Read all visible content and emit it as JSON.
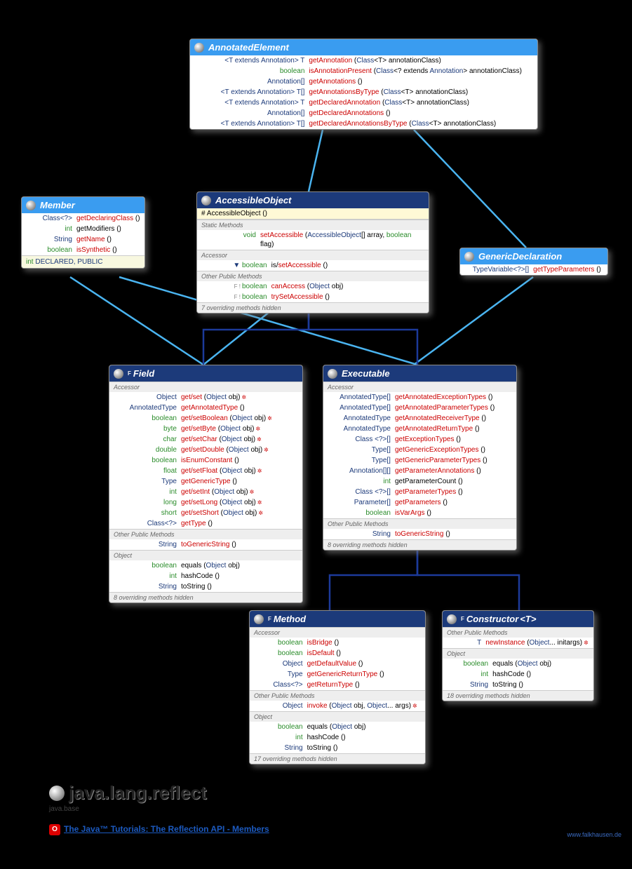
{
  "package": {
    "name": "java.lang.reflect",
    "module": "java.base",
    "tutorial_label": "The Java™ Tutorials: The Reflection API - Members",
    "site": "www.falkhausen.de"
  },
  "AnnotatedElement": {
    "title": "AnnotatedElement",
    "rows": [
      {
        "ret": "<T extends <t>Annotation</t>> T",
        "name": "getAnnotation",
        "args": "(<t>Class</t><T> annotationClass)"
      },
      {
        "ret": "<kw>boolean</kw>",
        "name": "isAnnotationPresent",
        "args": "(<t>Class</t><? extends <t>Annotation</t>> annotationClass)"
      },
      {
        "ret": "<t>Annotation</t>[]",
        "name": "getAnnotations",
        "args": "()"
      },
      {
        "ret": "<T extends <t>Annotation</t>> T[]",
        "name": "getAnnotationsByType",
        "args": "(<t>Class</t><T> annotationClass)"
      },
      {
        "ret": "<T extends <t>Annotation</t>> T",
        "name": "getDeclaredAnnotation",
        "args": "(<t>Class</t><T> annotationClass)"
      },
      {
        "ret": "<t>Annotation</t>[]",
        "name": "getDeclaredAnnotations",
        "args": "()"
      },
      {
        "ret": "<T extends <t>Annotation</t>> T[]",
        "name": "getDeclaredAnnotationsByType",
        "args": "(<t>Class</t><T> annotationClass)"
      }
    ]
  },
  "Member": {
    "title": "Member",
    "rows": [
      {
        "ret": "<t>Class</t><?>",
        "name": "getDeclaringClass",
        "args": "()"
      },
      {
        "ret": "<kw>int</kw>",
        "name_black": "getModifiers",
        "args": "()"
      },
      {
        "ret": "<t>String</t>",
        "name": "getName",
        "args": "()"
      },
      {
        "ret": "<kw>boolean</kw>",
        "name": "isSynthetic",
        "args": "()"
      }
    ],
    "consts": "int DECLARED, PUBLIC"
  },
  "AccessibleObject": {
    "title": "AccessibleObject",
    "constructor": "# AccessibleObject ()",
    "sections": {
      "static": "Static Methods",
      "static_rows": [
        {
          "ret": "<kw>void</kw>",
          "name": "setAccessible",
          "args": "(<t>AccessibleObject</t>[] array, <kw>boolean</kw> flag)"
        }
      ],
      "accessor": "Accessor",
      "accessor_rows": [
        {
          "ret": "▼ <kw>boolean</kw>",
          "name_black": "is/",
          "name": "setAccessible",
          "args": "()"
        }
      ],
      "other": "Other Public Methods",
      "other_rows": [
        {
          "flag": "F !",
          "ret": "<kw>boolean</kw>",
          "name": "canAccess",
          "args": "(<t>Object</t> obj)"
        },
        {
          "flag": "F !",
          "ret": "<kw>boolean</kw>",
          "name": "trySetAccessible",
          "args": "()"
        }
      ],
      "hidden": "7 overriding methods hidden"
    }
  },
  "GenericDeclaration": {
    "title": "GenericDeclaration",
    "rows": [
      {
        "ret": "<t>TypeVariable</t><?>[]",
        "name": "getTypeParameters",
        "args": "()"
      }
    ]
  },
  "Field": {
    "title": "Field",
    "sup": "F",
    "accessor": "Accessor",
    "rows": [
      {
        "ret": "<t>Object</t>",
        "name": "get/set",
        "args": "(<t>Object</t> obj)",
        "ex": true
      },
      {
        "ret": "<t>AnnotatedType</t>",
        "name": "getAnnotatedType",
        "args": "()"
      },
      {
        "ret": "<kw>boolean</kw>",
        "name": "get/setBoolean",
        "args": "(<t>Object</t> obj)",
        "ex": true
      },
      {
        "ret": "<kw>byte</kw>",
        "name": "get/setByte",
        "args": "(<t>Object</t> obj)",
        "ex": true
      },
      {
        "ret": "<kw>char</kw>",
        "name": "get/setChar",
        "args": "(<t>Object</t> obj)",
        "ex": true
      },
      {
        "ret": "<kw>double</kw>",
        "name": "get/setDouble",
        "args": "(<t>Object</t> obj)",
        "ex": true
      },
      {
        "ret": "<kw>boolean</kw>",
        "name": "isEnumConstant",
        "args": "()"
      },
      {
        "ret": "<kw>float</kw>",
        "name": "get/setFloat",
        "args": "(<t>Object</t> obj)",
        "ex": true
      },
      {
        "ret": "<t>Type</t>",
        "name": "getGenericType",
        "args": "()"
      },
      {
        "ret": "<kw>int</kw>",
        "name": "get/setInt",
        "args": "(<t>Object</t> obj)",
        "ex": true
      },
      {
        "ret": "<kw>long</kw>",
        "name": "get/setLong",
        "args": "(<t>Object</t> obj)",
        "ex": true
      },
      {
        "ret": "<kw>short</kw>",
        "name": "get/setShort",
        "args": "(<t>Object</t> obj)",
        "ex": true
      },
      {
        "ret": "<t>Class</t><?>",
        "name": "getType",
        "args": "()"
      }
    ],
    "other": "Other Public Methods",
    "other_rows": [
      {
        "ret": "<t>String</t>",
        "name": "toGenericString",
        "args": "()"
      }
    ],
    "object": "Object",
    "object_rows": [
      {
        "ret": "<kw>boolean</kw>",
        "name_black": "equals",
        "args": "(<t>Object</t> obj)"
      },
      {
        "ret": "<kw>int</kw>",
        "name_black": "hashCode",
        "args": "()"
      },
      {
        "ret": "<t>String</t>",
        "name_black": "toString",
        "args": "()"
      }
    ],
    "hidden": "8 overriding methods hidden"
  },
  "Executable": {
    "title": "Executable",
    "accessor": "Accessor",
    "rows": [
      {
        "ret": "<t>AnnotatedType</t>[]",
        "name": "getAnnotatedExceptionTypes",
        "args": "()"
      },
      {
        "ret": "<t>AnnotatedType</t>[]",
        "name": "getAnnotatedParameterTypes",
        "args": "()"
      },
      {
        "ret": "<t>AnnotatedType</t>",
        "name": "getAnnotatedReceiverType",
        "args": "()"
      },
      {
        "ret": "<t>AnnotatedType</t>",
        "name": "getAnnotatedReturnType",
        "args": "()"
      },
      {
        "ret": "<t>Class</t> <?>[]",
        "name": "getExceptionTypes",
        "args": "()"
      },
      {
        "ret": "<t>Type</t>[]",
        "name": "getGenericExceptionTypes",
        "args": "()"
      },
      {
        "ret": "<t>Type</t>[]",
        "name": "getGenericParameterTypes",
        "args": "()"
      },
      {
        "ret": "<t>Annotation</t>[][]",
        "name": "getParameterAnnotations",
        "args": "()"
      },
      {
        "ret": "<kw>int</kw>",
        "name_black": "getParameterCount",
        "args": "()"
      },
      {
        "ret": "<t>Class</t> <?>[]",
        "name": "getParameterTypes",
        "args": "()"
      },
      {
        "ret": "<t>Parameter</t>[]",
        "name": "getParameters",
        "args": "()"
      },
      {
        "ret": "<kw>boolean</kw>",
        "name": "isVarArgs",
        "args": "()"
      }
    ],
    "other": "Other Public Methods",
    "other_rows": [
      {
        "ret": "<t>String</t>",
        "name": "toGenericString",
        "args": "()"
      }
    ],
    "hidden": "8 overriding methods hidden"
  },
  "Method": {
    "title": "Method",
    "sup": "F",
    "accessor": "Accessor",
    "rows": [
      {
        "ret": "<kw>boolean</kw>",
        "name": "isBridge",
        "args": "()"
      },
      {
        "ret": "<kw>boolean</kw>",
        "name": "isDefault",
        "args": "()"
      },
      {
        "ret": "<t>Object</t>",
        "name": "getDefaultValue",
        "args": "()"
      },
      {
        "ret": "<t>Type</t>",
        "name": "getGenericReturnType",
        "args": "()"
      },
      {
        "ret": "<t>Class</t><?>",
        "name": "getReturnType",
        "args": "()"
      }
    ],
    "other": "Other Public Methods",
    "other_rows": [
      {
        "ret": "<t>Object</t>",
        "name": "invoke",
        "args": "(<t>Object</t> obj, <t>Object</t>... args)",
        "ex": true
      }
    ],
    "object": "Object",
    "object_rows": [
      {
        "ret": "<kw>boolean</kw>",
        "name_black": "equals",
        "args": "(<t>Object</t> obj)"
      },
      {
        "ret": "<kw>int</kw>",
        "name_black": "hashCode",
        "args": "()"
      },
      {
        "ret": "<t>String</t>",
        "name_black": "toString",
        "args": "()"
      }
    ],
    "hidden": "17 overriding methods hidden"
  },
  "Constructor": {
    "title": "Constructor",
    "sup": "F",
    "param": "<T>",
    "other": "Other Public Methods",
    "other_rows": [
      {
        "ret": "T",
        "name": "newInstance",
        "args": "(<t>Object</t>... initargs)",
        "ex": true
      }
    ],
    "object": "Object",
    "object_rows": [
      {
        "ret": "<kw>boolean</kw>",
        "name_black": "equals",
        "args": "(<t>Object</t> obj)"
      },
      {
        "ret": "<kw>int</kw>",
        "name_black": "hashCode",
        "args": "()"
      },
      {
        "ret": "<t>String</t>",
        "name_black": "toString",
        "args": "()"
      }
    ],
    "hidden": "18 overriding methods hidden"
  }
}
